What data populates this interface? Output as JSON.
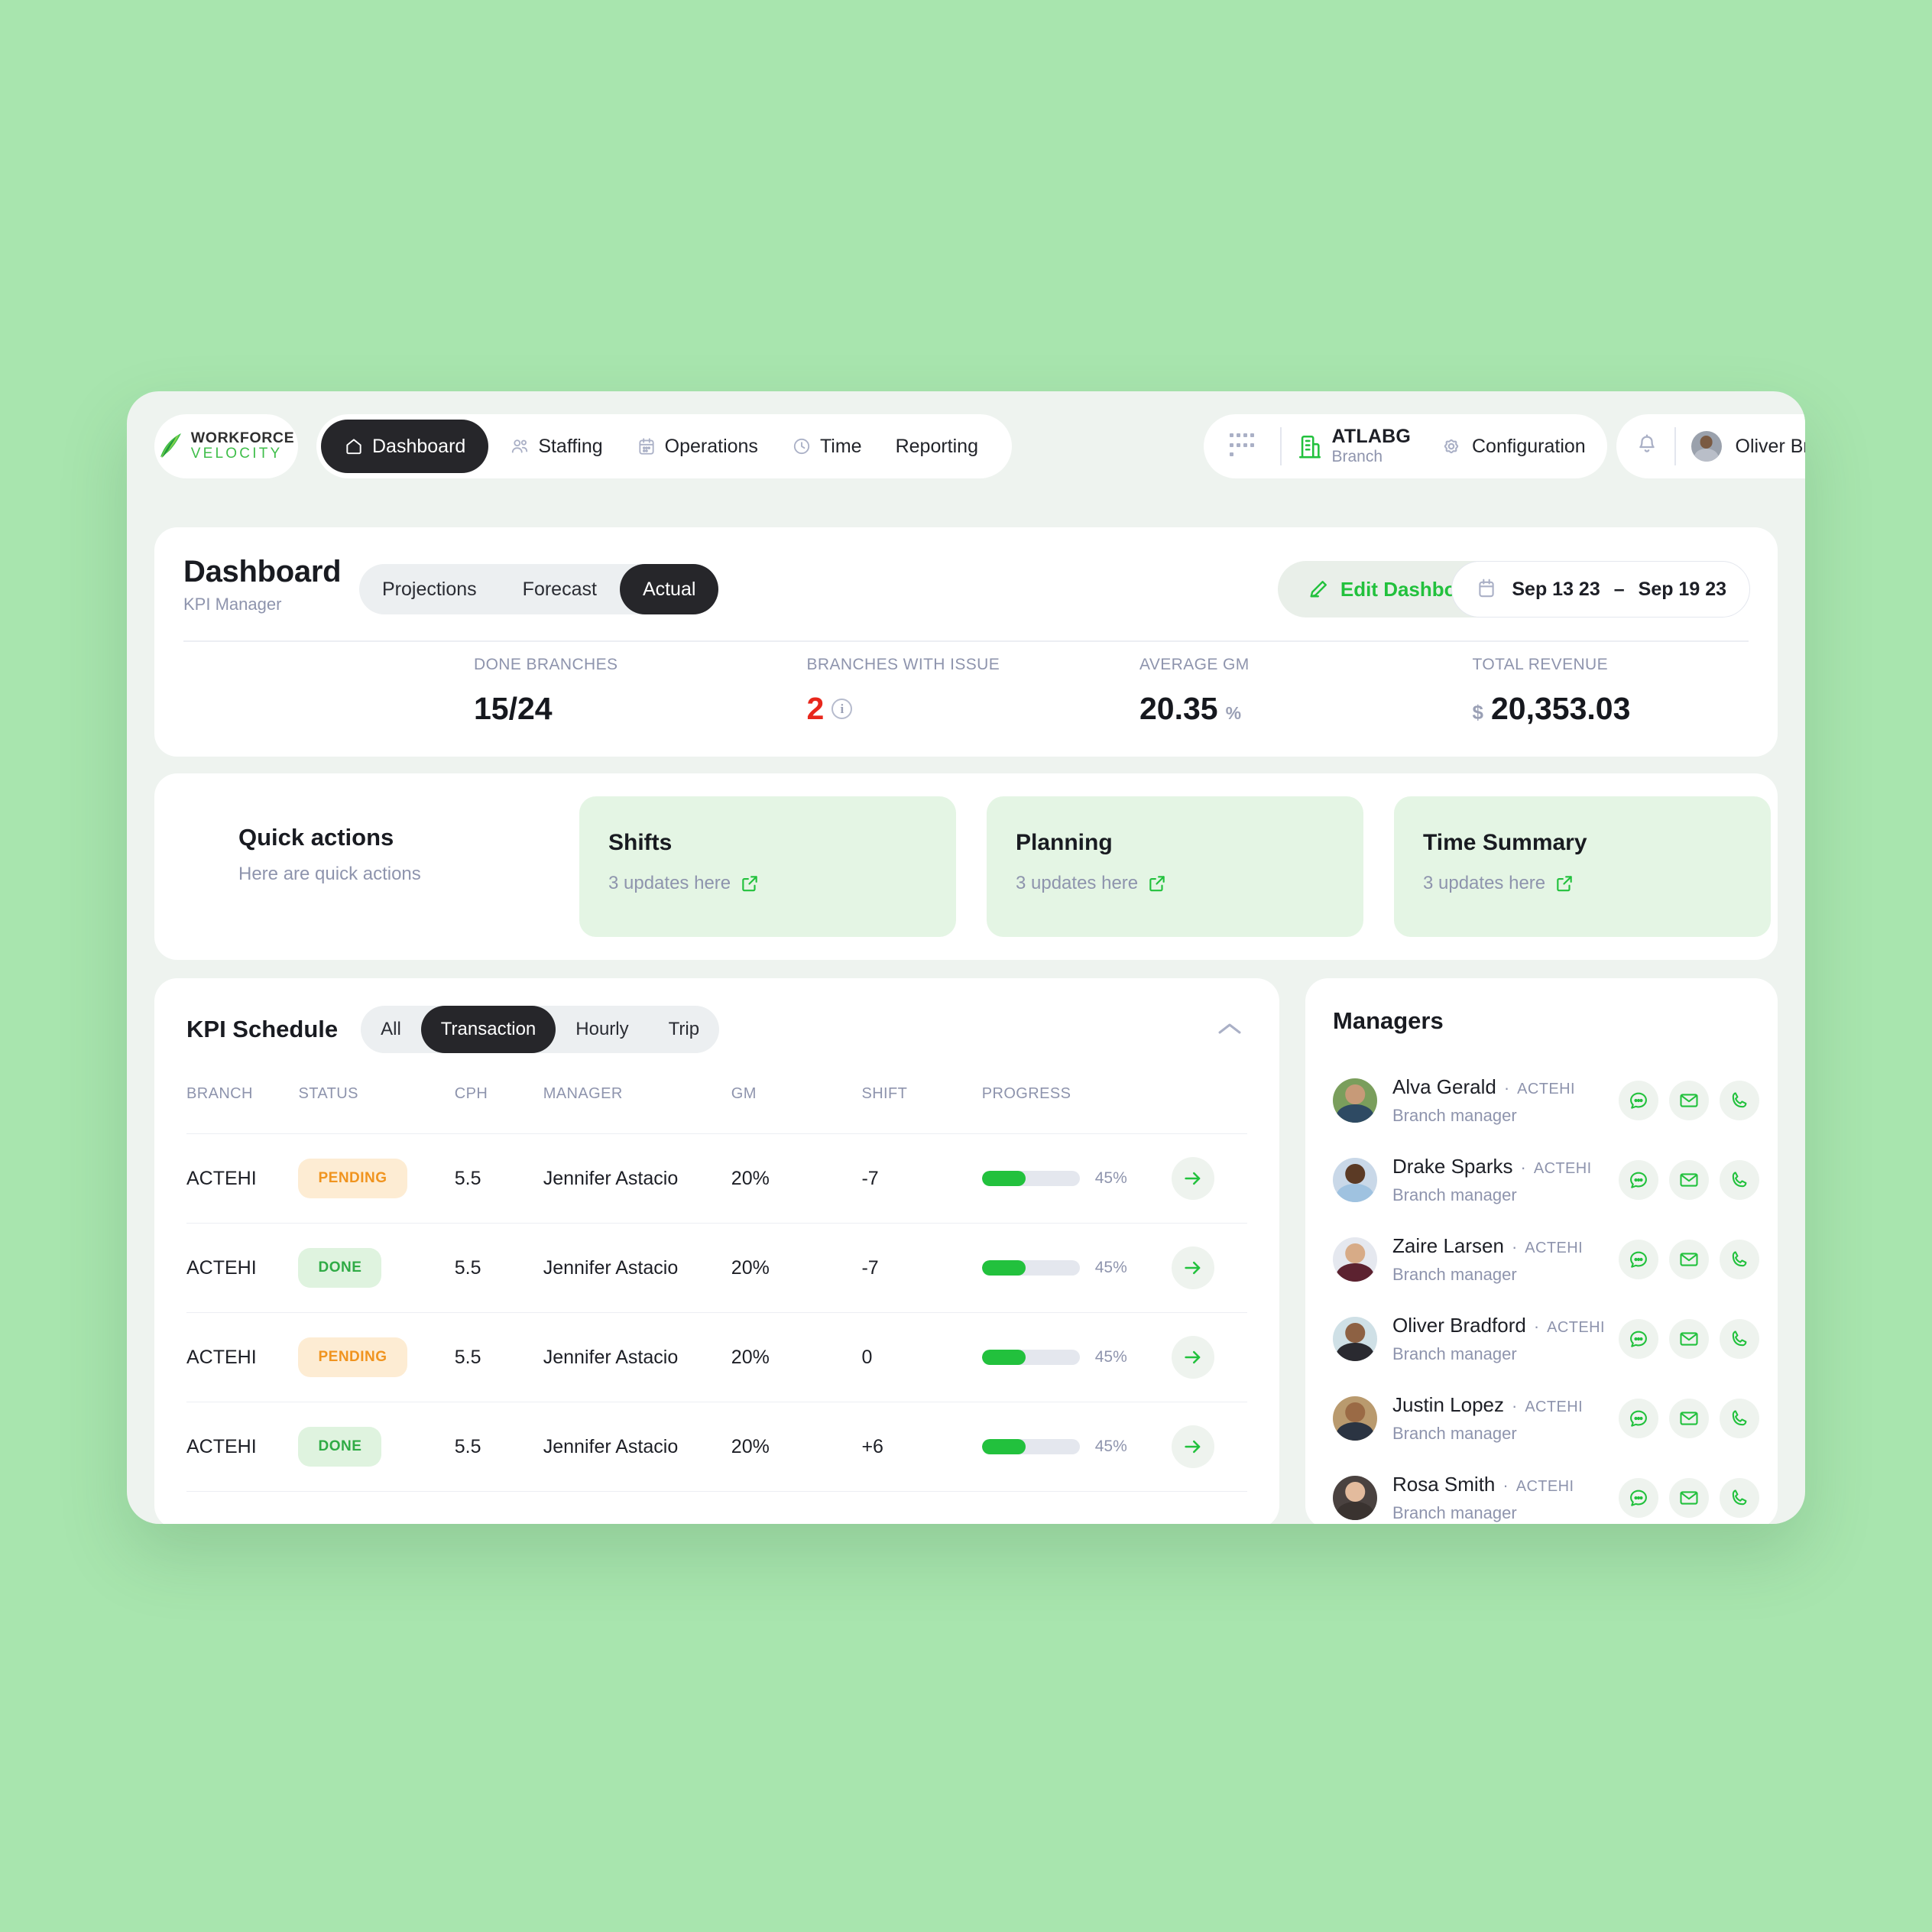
{
  "topbar": {
    "logo": {
      "line1": "WORKFORCE",
      "line2": "VELOCITY"
    },
    "nav": [
      {
        "label": "Dashboard",
        "icon": "home-icon",
        "active": true
      },
      {
        "label": "Staffing",
        "icon": "people-icon",
        "active": false
      },
      {
        "label": "Operations",
        "icon": "calendar-icon",
        "active": false
      },
      {
        "label": "Time",
        "icon": "clock-icon",
        "active": false
      },
      {
        "label": "Reporting",
        "icon": "",
        "active": false
      }
    ],
    "branch": {
      "name": "ATLABG",
      "sub": "Branch"
    },
    "configuration_label": "Configuration",
    "user_name": "Oliver Bradford"
  },
  "dashboard": {
    "title": "Dashboard",
    "subtitle": "KPI Manager",
    "segments": [
      {
        "label": "Projections",
        "active": false
      },
      {
        "label": "Forecast",
        "active": false
      },
      {
        "label": "Actual",
        "active": true
      }
    ],
    "edit_label": "Edit Dashboard",
    "date_start": "Sep 13 23",
    "date_sep": "–",
    "date_end": "Sep 19 23",
    "stats": [
      {
        "label": "DONE BRANCHES",
        "prefix": "",
        "value": "15/24",
        "unit": "",
        "danger": false,
        "info": false
      },
      {
        "label": "BRANCHES WITH ISSUE",
        "prefix": "",
        "value": "2",
        "unit": "",
        "danger": true,
        "info": true
      },
      {
        "label": "AVERAGE  GM",
        "prefix": "",
        "value": "20.35",
        "unit": "%",
        "danger": false,
        "info": false
      },
      {
        "label": "TOTAL REVENUE",
        "prefix": "$",
        "value": "20,353.03",
        "unit": "",
        "danger": false,
        "info": false
      }
    ]
  },
  "quick_actions": {
    "title": "Quick actions",
    "subtitle": "Here are quick actions",
    "tiles": [
      {
        "title": "Shifts",
        "sub": "3 updates here"
      },
      {
        "title": "Planning",
        "sub": "3 updates here"
      },
      {
        "title": "Time Summary",
        "sub": "3 updates here"
      }
    ]
  },
  "kpi_schedule": {
    "title": "KPI Schedule",
    "segments": [
      {
        "label": "All",
        "active": false
      },
      {
        "label": "Transaction",
        "active": true
      },
      {
        "label": "Hourly",
        "active": false
      },
      {
        "label": "Trip",
        "active": false
      }
    ],
    "columns": [
      "BRANCH",
      "STATUS",
      "CPH",
      "MANAGER",
      "GM",
      "SHIFT",
      "PROGRESS",
      ""
    ],
    "rows": [
      {
        "branch": "ACTEHI",
        "status": "PENDING",
        "status_kind": "pending",
        "cph": "5.5",
        "manager": "Jennifer Astacio",
        "gm": "20%",
        "shift": "-7",
        "shift_kind": "neg",
        "progress_pct": 45,
        "progress_label": "45%"
      },
      {
        "branch": "ACTEHI",
        "status": "DONE",
        "status_kind": "done",
        "cph": "5.5",
        "manager": "Jennifer Astacio",
        "gm": "20%",
        "shift": "-7",
        "shift_kind": "neg",
        "progress_pct": 45,
        "progress_label": "45%"
      },
      {
        "branch": "ACTEHI",
        "status": "PENDING",
        "status_kind": "pending",
        "cph": "5.5",
        "manager": "Jennifer Astacio",
        "gm": "20%",
        "shift": "0",
        "shift_kind": "zero",
        "progress_pct": 45,
        "progress_label": "45%"
      },
      {
        "branch": "ACTEHI",
        "status": "DONE",
        "status_kind": "done",
        "cph": "5.5",
        "manager": "Jennifer Astacio",
        "gm": "20%",
        "shift": "+6",
        "shift_kind": "pos",
        "progress_pct": 45,
        "progress_label": "45%"
      }
    ]
  },
  "managers": {
    "title": "Managers",
    "items": [
      {
        "name": "Alva Gerald",
        "branch": "ACTEHI",
        "role": "Branch manager",
        "skin": "#c79a78",
        "bg": "#7a9e5c",
        "shirt": "#2e4a63"
      },
      {
        "name": "Drake Sparks",
        "branch": "ACTEHI",
        "role": "Branch manager",
        "skin": "#5b3a25",
        "bg": "#c9d8e8",
        "shirt": "#9fc2e0"
      },
      {
        "name": "Zaire Larsen",
        "branch": "ACTEHI",
        "role": "Branch manager",
        "skin": "#d7ab87",
        "bg": "#e5e8ef",
        "shirt": "#5c2230"
      },
      {
        "name": "Oliver Bradford",
        "branch": "ACTEHI",
        "role": "Branch manager",
        "skin": "#8d6143",
        "bg": "#cfe0e6",
        "shirt": "#2a2a30"
      },
      {
        "name": "Justin Lopez",
        "branch": "ACTEHI",
        "role": "Branch manager",
        "skin": "#9a6a45",
        "bg": "#b99a6e",
        "shirt": "#2b3442"
      },
      {
        "name": "Rosa Smith",
        "branch": "ACTEHI",
        "role": "Branch manager",
        "skin": "#e3bb9d",
        "bg": "#4a4240",
        "shirt": "#3a3330"
      }
    ],
    "actions": [
      "chat-icon",
      "mail-icon",
      "phone-icon"
    ]
  },
  "colors": {
    "page_bg": "#a8e5ae",
    "window_bg": "#eef3ef",
    "accent_green": "#22c13d",
    "danger_red": "#e8271c",
    "warning_orange": "#f0941f",
    "muted": "#8e94ad",
    "dark": "#26262a"
  }
}
